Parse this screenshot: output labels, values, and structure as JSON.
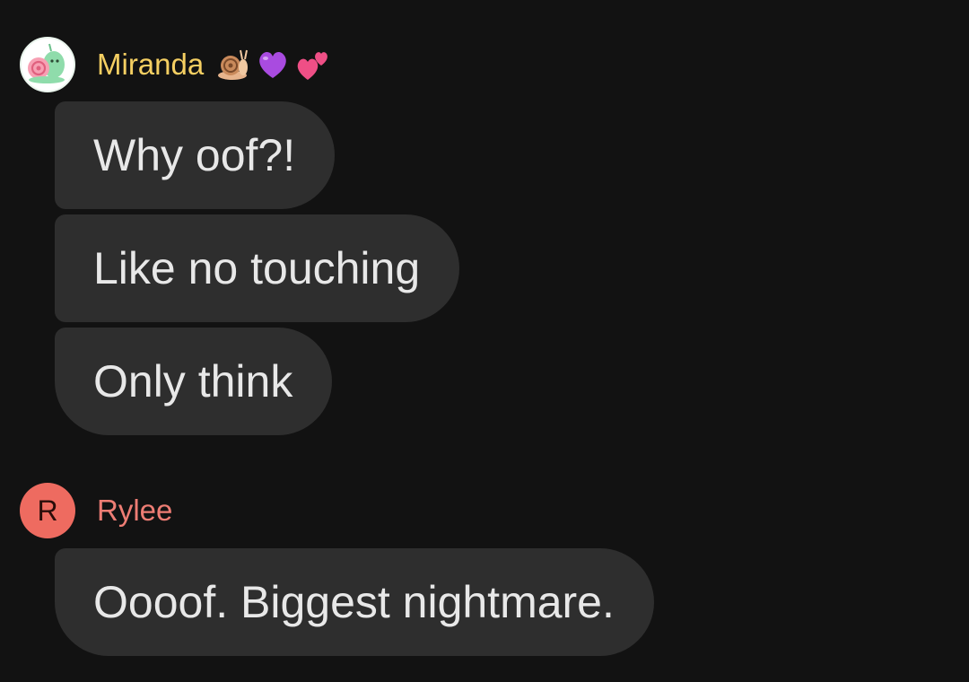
{
  "messages": [
    {
      "sender": "Miranda",
      "sender_color": "#f5cf62",
      "avatar_kind": "snail-sticker-image",
      "name_emojis": [
        "snail-emoji",
        "purple-heart-emoji",
        "two-hearts-emoji"
      ],
      "lines": [
        "Why oof?!",
        "Like no touching",
        "Only think"
      ]
    },
    {
      "sender": "Rylee",
      "sender_color": "#ee7d74",
      "avatar_initial": "R",
      "avatar_color": "#ee6b60",
      "lines": [
        "Oooof. Biggest nightmare."
      ]
    }
  ],
  "bubble_color": "#2e2e2e",
  "background_color": "#121212"
}
